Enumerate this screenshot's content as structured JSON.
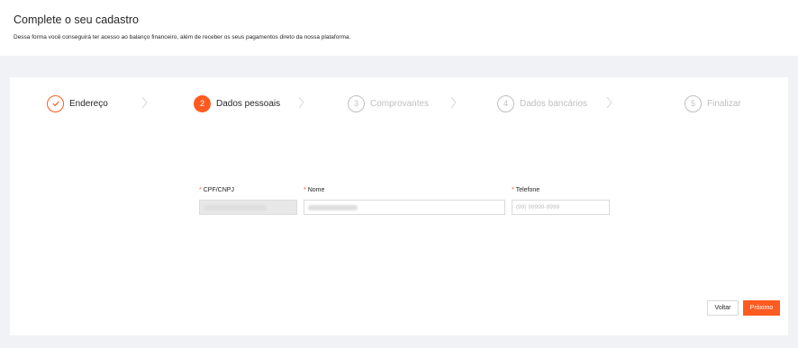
{
  "header": {
    "title": "Complete o seu cadastro",
    "subtitle": "Dessa forma você conseguirá ter acesso ao balanço financeiro, além de receber os seus pagamentos direto da nossa plataforma."
  },
  "steps": [
    {
      "number": "",
      "label": "Endereço",
      "status": "done"
    },
    {
      "number": "2",
      "label": "Dados pessoais",
      "status": "active"
    },
    {
      "number": "3",
      "label": "Comprovantes",
      "status": "wait"
    },
    {
      "number": "4",
      "label": "Dados bancários",
      "status": "wait"
    },
    {
      "number": "5",
      "label": "Finalizar",
      "status": "wait"
    }
  ],
  "form": {
    "required_mark": "*",
    "cpf": {
      "label": "CPF/CNPJ",
      "value": ""
    },
    "nome": {
      "label": "Nome",
      "value": ""
    },
    "telefone": {
      "label": "Telefone",
      "placeholder": "(99) 99999-9999"
    }
  },
  "actions": {
    "back_label": "Voltar",
    "next_label": "Próximo"
  },
  "colors": {
    "accent": "#ff5a1f",
    "required": "#ff4d4f",
    "inactive": "#bfbfbf"
  },
  "icons": {
    "done_step": "check-icon",
    "separator": "chevron-right-icon"
  }
}
